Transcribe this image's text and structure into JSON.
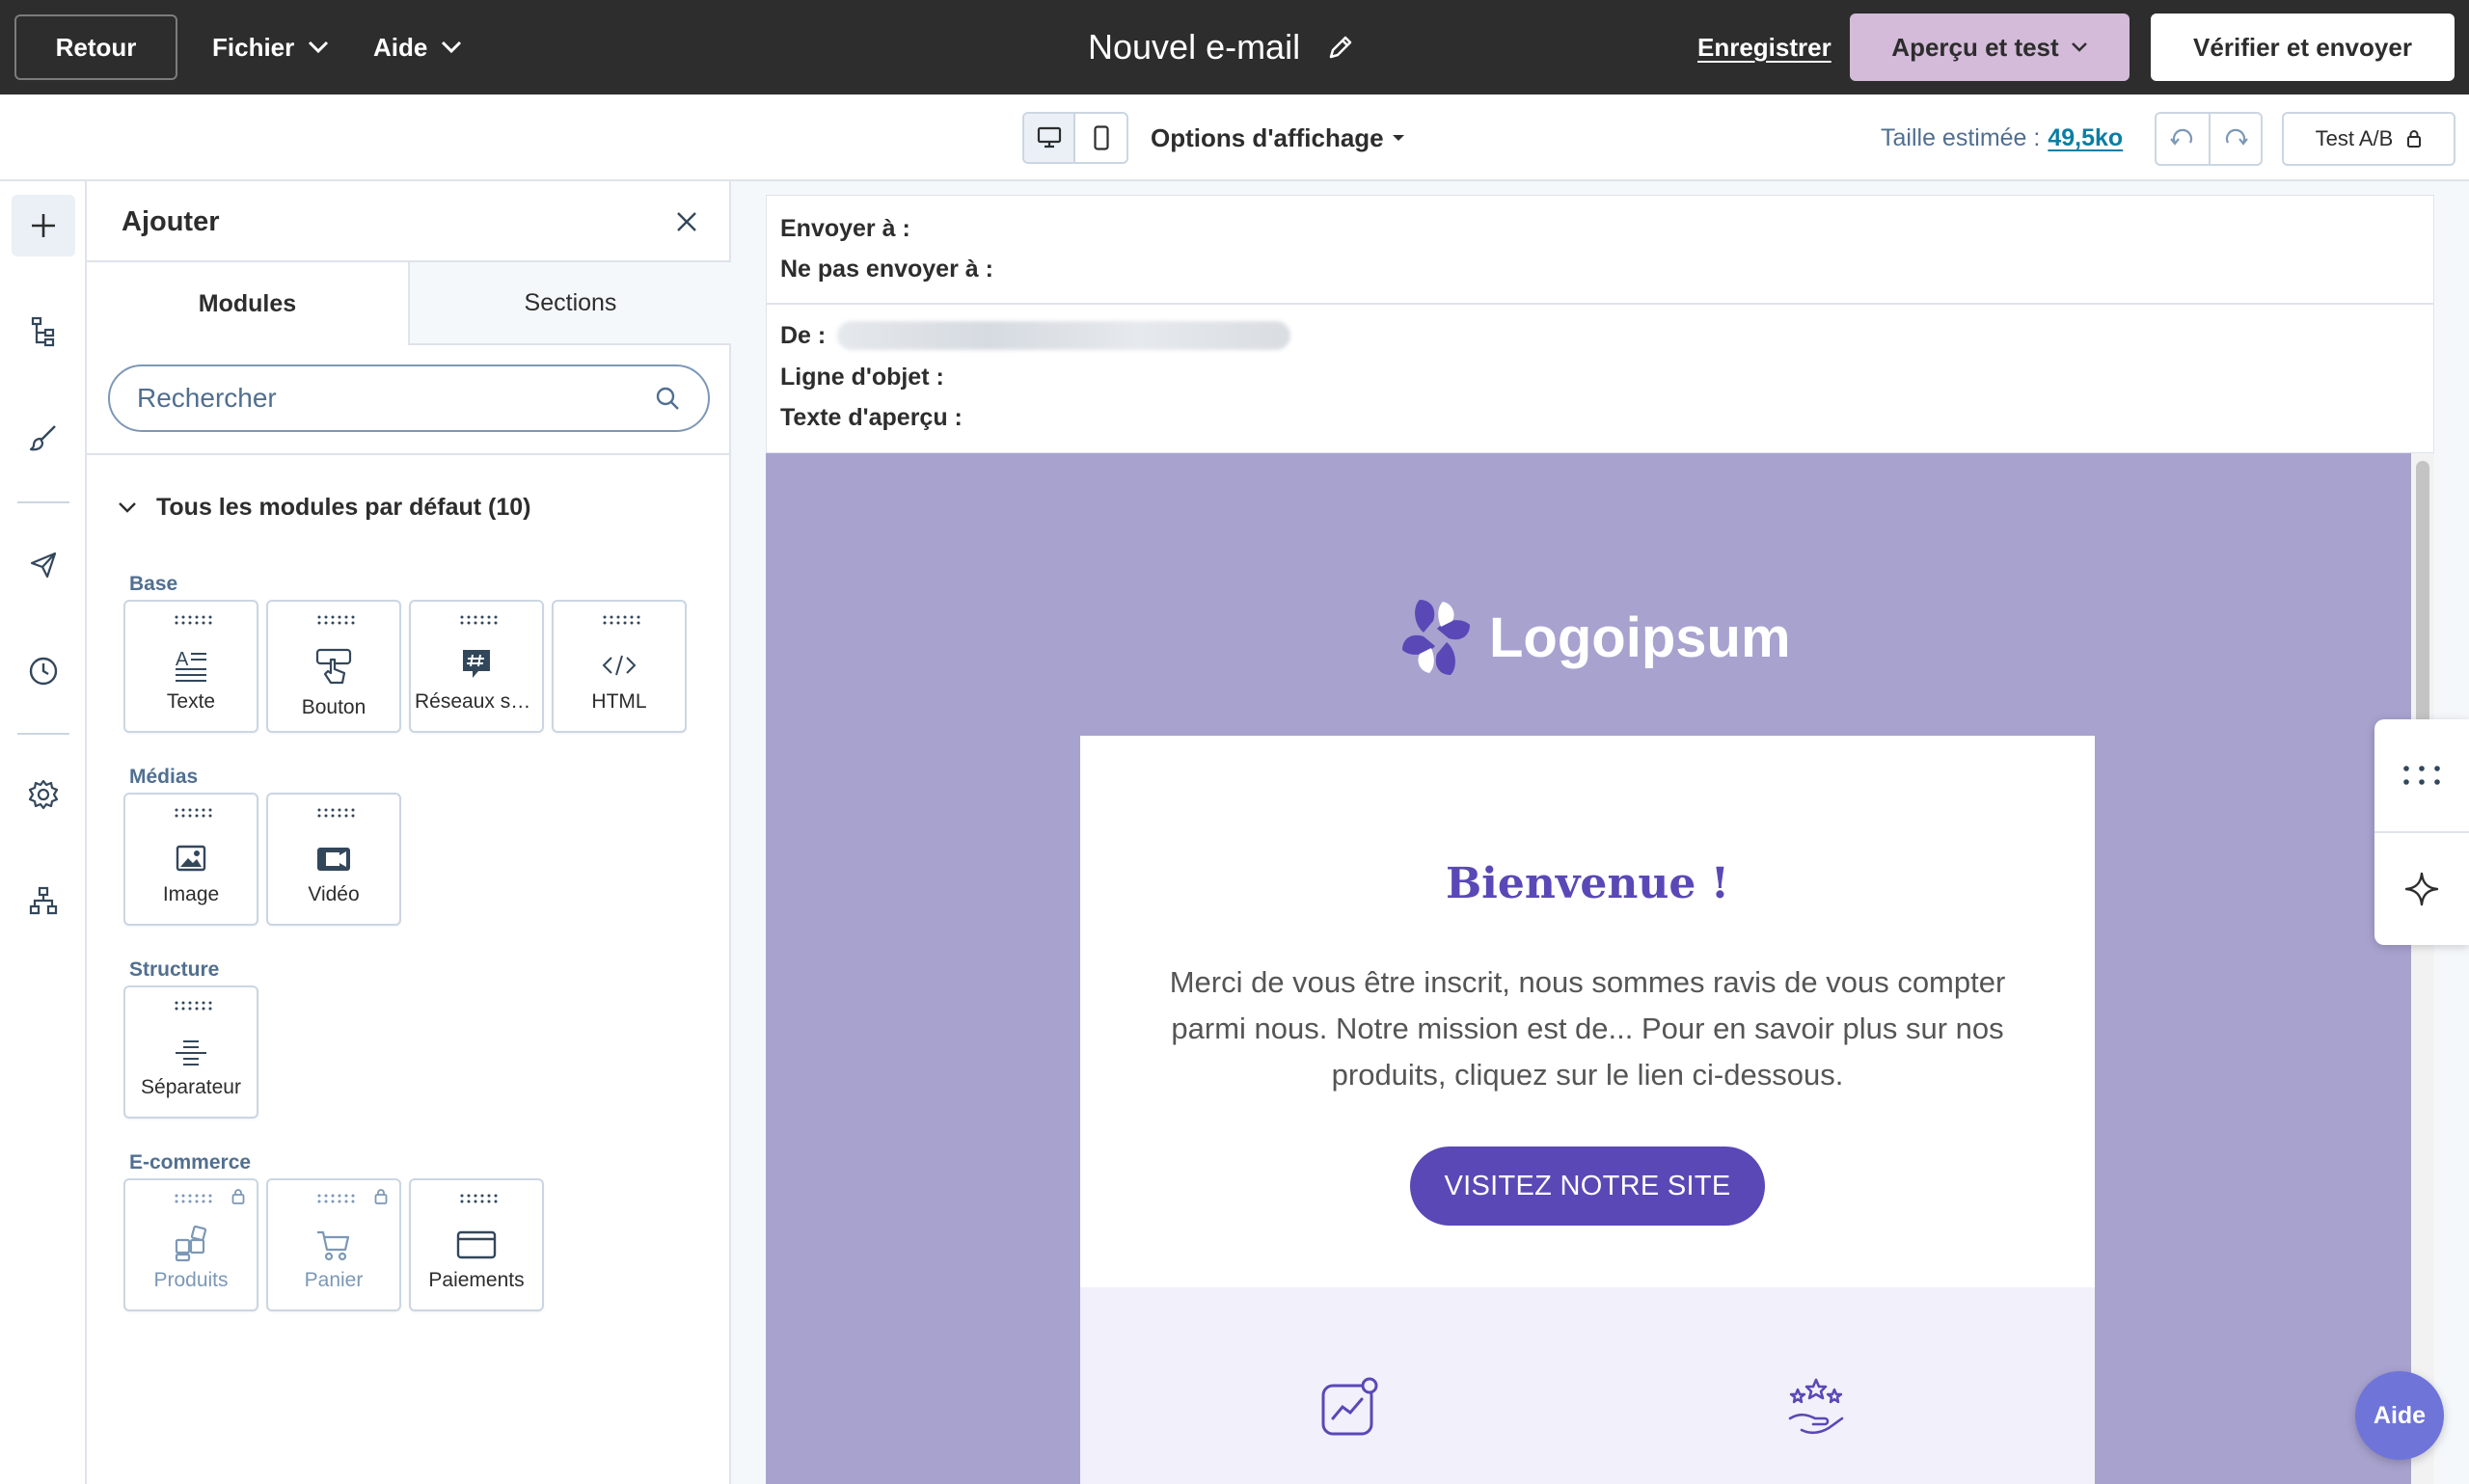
{
  "topbar": {
    "back_label": "Retour",
    "file_menu": "Fichier",
    "help_menu": "Aide",
    "title": "Nouvel e-mail",
    "save_label": "Enregistrer",
    "preview_label": "Aperçu et test",
    "send_label": "Vérifier et envoyer"
  },
  "subbar": {
    "display_options": "Options d'affichage",
    "size_label": "Taille estimée :",
    "size_value": "49,5ko",
    "ab_test": "Test A/B"
  },
  "panel": {
    "title": "Ajouter",
    "tabs": [
      "Modules",
      "Sections"
    ],
    "search_placeholder": "Rechercher",
    "group_title": "Tous les modules par défaut (10)",
    "categories": {
      "base": "Base",
      "media": "Médias",
      "structure": "Structure",
      "ecommerce": "E-commerce"
    },
    "modules": {
      "text": "Texte",
      "button": "Bouton",
      "social": "Réseaux sociaux",
      "html": "HTML",
      "image": "Image",
      "video": "Vidéo",
      "divider": "Séparateur",
      "products": "Produits",
      "cart": "Panier",
      "payments": "Paiements"
    }
  },
  "email_header": {
    "to_label": "Envoyer à :",
    "not_to_label": "Ne pas envoyer à :",
    "from_label": "De :",
    "subject_label": "Ligne d'objet :",
    "preview_text_label": "Texte d'aperçu :"
  },
  "email_body": {
    "logo_text": "Logoipsum",
    "heading": "Bienvenue !",
    "paragraph": "Merci de vous être inscrit, nous sommes ravis de vous compter parmi nous. Notre mission est de... Pour en savoir plus sur nos produits, cliquez sur le lien ci-dessous.",
    "cta_label": "VISITEZ NOTRE SITE"
  },
  "help_button": "Aide",
  "colors": {
    "topbar_bg": "#2d2d2d",
    "preview_btn": "#d3bbd9",
    "canvas_bg": "#a8a2cf",
    "brand_purple": "#5a48b6",
    "link_teal": "#0b7ea3",
    "help_btn": "#6f74d8"
  },
  "icons": {
    "rail": [
      "plus-icon",
      "layers-tree-icon",
      "brush-icon",
      "send-icon",
      "clock-icon",
      "gear-icon",
      "sitemap-icon"
    ],
    "devices": [
      "desktop-icon",
      "mobile-icon"
    ]
  }
}
